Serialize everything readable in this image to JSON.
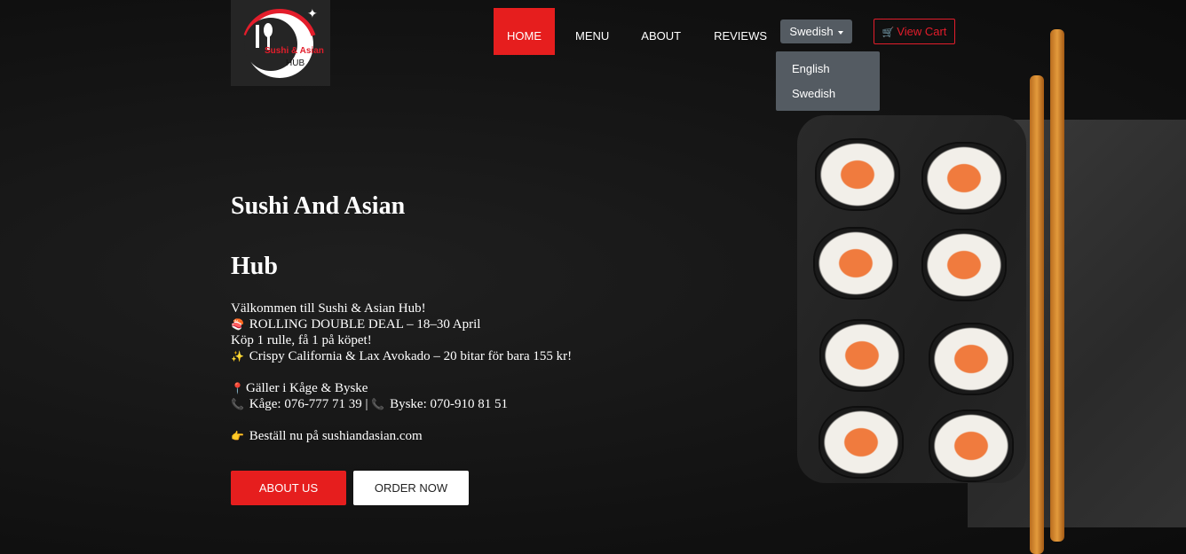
{
  "logo": {
    "line1": "Sushi & Asian",
    "line2": "HUB"
  },
  "nav": {
    "items": [
      {
        "label": "HOME",
        "active": true
      },
      {
        "label": "MENU",
        "active": false
      },
      {
        "label": "ABOUT",
        "active": false
      },
      {
        "label": "REVIEWS",
        "active": false
      }
    ]
  },
  "language": {
    "selected": "Swedish",
    "options": [
      "English",
      "Swedish"
    ]
  },
  "cart": {
    "label": "View Cart"
  },
  "hero": {
    "title_line1": "Sushi And Asian",
    "title_line2": "Hub",
    "lines": [
      {
        "emoji": "",
        "text": "Välkommen till Sushi & Asian Hub!"
      },
      {
        "emoji": "🍣",
        "text": "ROLLING DOUBLE DEAL – 18–30 April"
      },
      {
        "emoji": "",
        "text": "Köp 1 rulle, få 1 på köpet!"
      },
      {
        "emoji": "✨",
        "text": "Crispy California & Lax Avokado – 20 bitar för bara 155 kr!"
      },
      {
        "emoji": "",
        "text": ""
      },
      {
        "emoji": "📍",
        "text": "Gäller i Kåge & Byske"
      },
      {
        "emoji": "📞",
        "text": "Kåge: 076-777 71 39 |",
        "emoji2": "📞",
        "text2": "Byske: 070-910 81 51"
      },
      {
        "emoji": "",
        "text": ""
      },
      {
        "emoji": "👉",
        "text": "Beställ nu på sushiandasian.com"
      }
    ],
    "about_button": "ABOUT US",
    "order_button": "ORDER NOW"
  },
  "colors": {
    "accent": "#e61e1e",
    "dropdown": "#545b62"
  }
}
